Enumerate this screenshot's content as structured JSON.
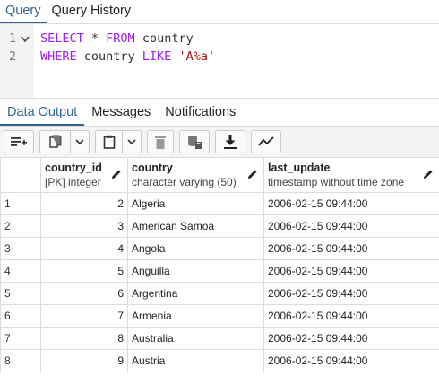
{
  "top_tabs": [
    "Query",
    "Query History"
  ],
  "editor": {
    "lines": [
      {
        "number": "1",
        "parts": [
          [
            "kw",
            "SELECT"
          ],
          [
            "plain",
            " * "
          ],
          [
            "kw",
            "FROM"
          ],
          [
            "plain",
            " country"
          ]
        ]
      },
      {
        "number": "2",
        "parts": [
          [
            "kw",
            "WHERE"
          ],
          [
            "plain",
            " country "
          ],
          [
            "kw",
            "LIKE"
          ],
          [
            "plain",
            " "
          ],
          [
            "str",
            "'A%a'"
          ]
        ]
      }
    ]
  },
  "result_tabs": [
    "Data Output",
    "Messages",
    "Notifications"
  ],
  "toolbar": {
    "icons": [
      "add-row-icon",
      "copy-icon",
      "dropdown-icon",
      "paste-icon",
      "dropdown-icon",
      "delete-icon",
      "save-data-icon",
      "download-icon",
      "graph-icon"
    ]
  },
  "grid": {
    "columns": [
      {
        "name": "country_id",
        "type": "[PK] integer"
      },
      {
        "name": "country",
        "type": "character varying (50)"
      },
      {
        "name": "last_update",
        "type": "timestamp without time zone"
      }
    ],
    "rows": [
      {
        "rn": "1",
        "country_id": "2",
        "country": "Algeria",
        "last_update": "2006-02-15 09:44:00"
      },
      {
        "rn": "2",
        "country_id": "3",
        "country": "American Samoa",
        "last_update": "2006-02-15 09:44:00"
      },
      {
        "rn": "3",
        "country_id": "4",
        "country": "Angola",
        "last_update": "2006-02-15 09:44:00"
      },
      {
        "rn": "4",
        "country_id": "5",
        "country": "Anguilla",
        "last_update": "2006-02-15 09:44:00"
      },
      {
        "rn": "5",
        "country_id": "6",
        "country": "Argentina",
        "last_update": "2006-02-15 09:44:00"
      },
      {
        "rn": "6",
        "country_id": "7",
        "country": "Armenia",
        "last_update": "2006-02-15 09:44:00"
      },
      {
        "rn": "7",
        "country_id": "8",
        "country": "Australia",
        "last_update": "2006-02-15 09:44:00"
      },
      {
        "rn": "8",
        "country_id": "9",
        "country": "Austria",
        "last_update": "2006-02-15 09:44:00"
      }
    ]
  },
  "colors": {
    "accent": "#326690",
    "keyword": "#a020f0",
    "string": "#a31515"
  }
}
